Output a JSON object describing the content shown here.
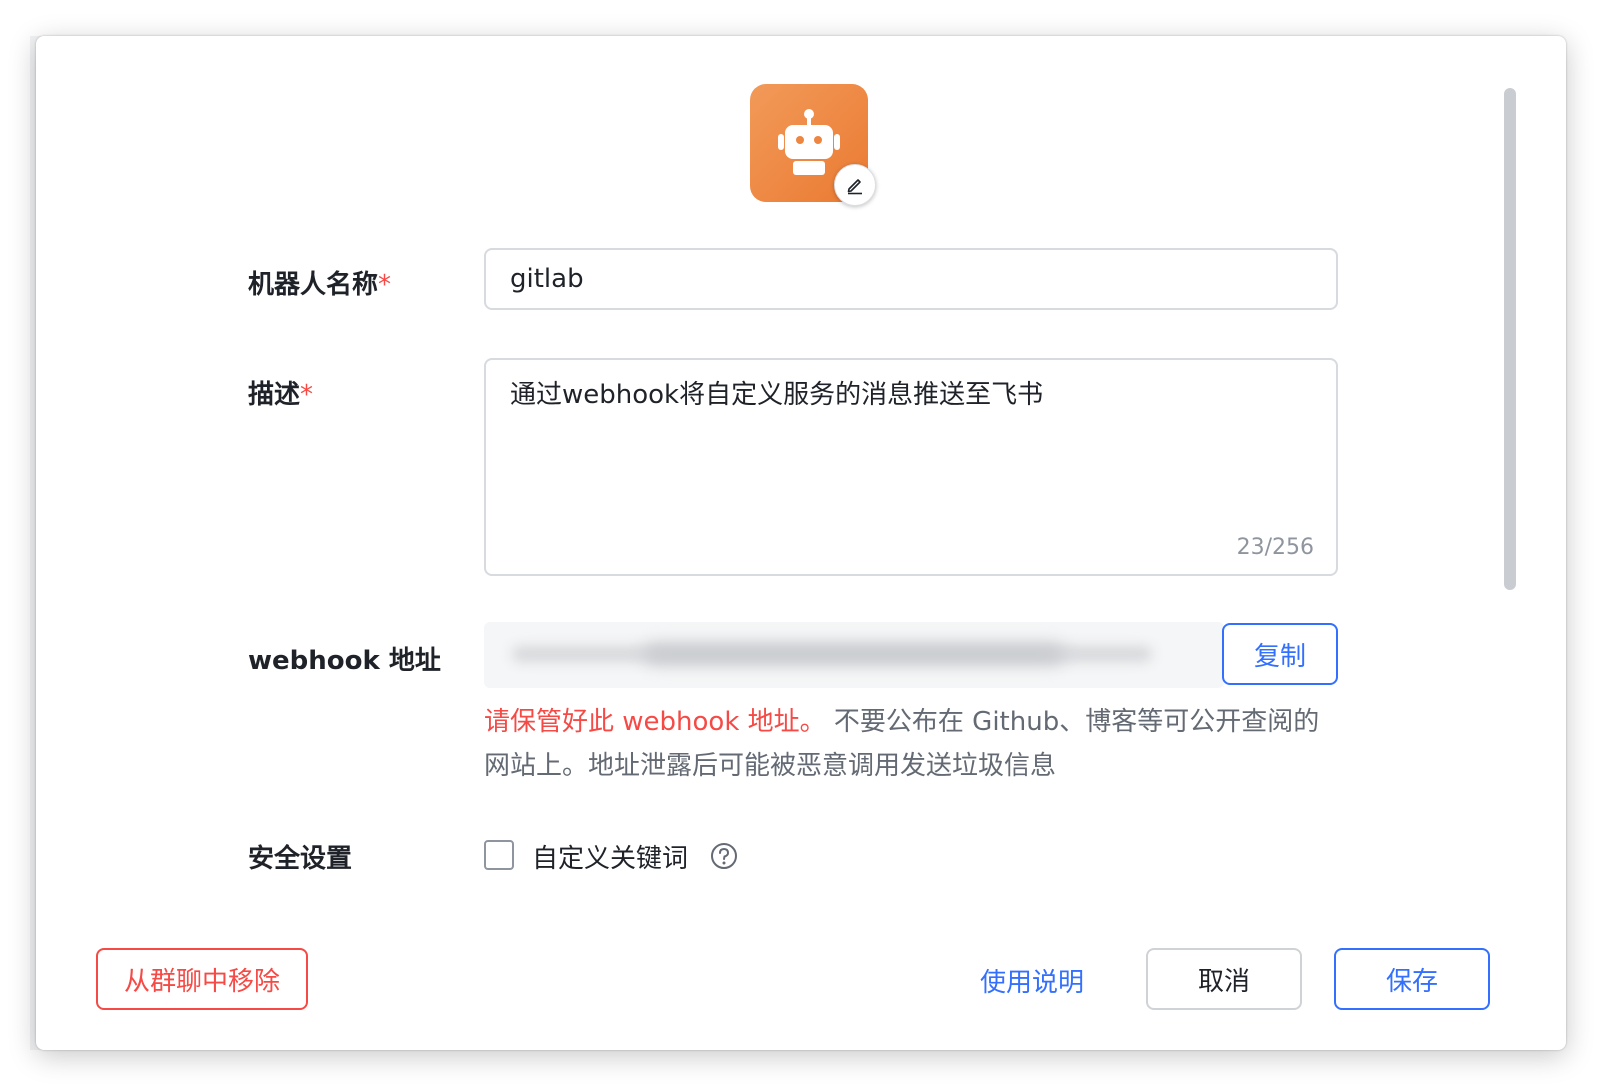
{
  "dialog": {
    "fields": {
      "name": {
        "label": "机器人名称",
        "required_mark": "*",
        "value": "gitlab"
      },
      "description": {
        "label": "描述",
        "required_mark": "*",
        "value": "通过webhook将自定义服务的消息推送至飞书",
        "counter": "23/256"
      },
      "webhook": {
        "label": "webhook 地址",
        "copy_label": "复制",
        "warning_highlight": "请保管好此 webhook 地址。",
        "warning_text": " 不要公布在 Github、博客等可公开查阅的网站上。地址泄露后可能被恶意调用发送垃圾信息"
      },
      "security": {
        "label": "安全设置",
        "checkbox_label": "自定义关键词",
        "checked": false
      }
    },
    "footer": {
      "remove_label": "从群聊中移除",
      "help_link": "使用说明",
      "cancel_label": "取消",
      "save_label": "保存"
    }
  },
  "icons": {
    "avatar": "robot-icon",
    "edit": "pencil-icon",
    "help": "question-circle-icon"
  },
  "colors": {
    "primary": "#3370ff",
    "danger": "#f54a45",
    "avatar_bg": "#ee8540"
  }
}
